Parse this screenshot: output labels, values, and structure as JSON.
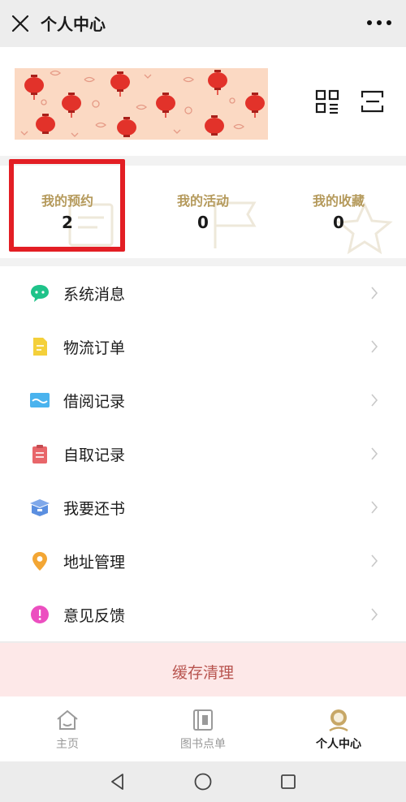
{
  "window": {
    "title": "个人中心",
    "close_icon": "close-icon",
    "more_icon": "more-icon"
  },
  "header": {
    "qr_icon": "qr-code-icon",
    "scan_icon": "scan-icon"
  },
  "stats": [
    {
      "label": "我的预约",
      "value": "2"
    },
    {
      "label": "我的活动",
      "value": "0"
    },
    {
      "label": "我的收藏",
      "value": "0"
    }
  ],
  "menu": [
    {
      "label": "系统消息",
      "icon": "chat-bubble-icon",
      "color": "#1fc38a"
    },
    {
      "label": "物流订单",
      "icon": "document-icon",
      "color": "#f4d03a"
    },
    {
      "label": "借阅记录",
      "icon": "borrow-record-icon",
      "color": "#4ab3ee"
    },
    {
      "label": "自取记录",
      "icon": "clipboard-icon",
      "color": "#e8666a"
    },
    {
      "label": "我要还书",
      "icon": "box-icon",
      "color": "#5b8fe0"
    },
    {
      "label": "地址管理",
      "icon": "location-pin-icon",
      "color": "#f3a634"
    },
    {
      "label": "意见反馈",
      "icon": "feedback-icon",
      "color": "#ec4fc0"
    }
  ],
  "cache_button": {
    "label": "缓存清理"
  },
  "tabs": [
    {
      "label": "主页",
      "icon": "home-icon",
      "active": false
    },
    {
      "label": "图书点单",
      "icon": "book-icon",
      "active": false
    },
    {
      "label": "个人中心",
      "icon": "profile-icon",
      "active": true
    }
  ],
  "colors": {
    "accent_gold": "#b59a5c",
    "highlight_red": "#e31e24",
    "cache_bg": "#fde8e8",
    "cache_text": "#b8544f"
  }
}
